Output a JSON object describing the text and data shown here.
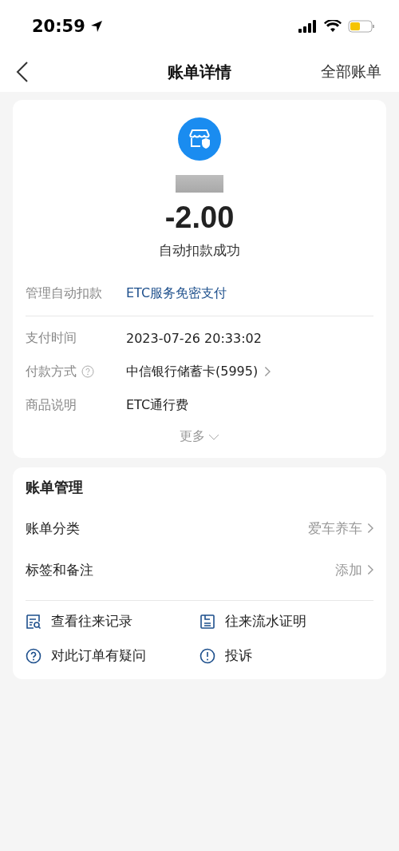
{
  "status_bar": {
    "time": "20:59"
  },
  "nav": {
    "title": "账单详情",
    "action": "全部账单"
  },
  "summary": {
    "amount": "-2.00",
    "status": "自动扣款成功",
    "manage_label": "管理自动扣款",
    "manage_link": "ETC服务免密支付"
  },
  "details": [
    {
      "label": "支付时间",
      "value": "2023-07-26 20:33:02",
      "help": false,
      "link": false
    },
    {
      "label": "付款方式",
      "value": "中信银行储蓄卡(5995)",
      "help": true,
      "link": true
    },
    {
      "label": "商品说明",
      "value": "ETC通行费",
      "help": false,
      "link": false
    }
  ],
  "more": "更多",
  "management": {
    "title": "账单管理",
    "rows": [
      {
        "label": "账单分类",
        "value": "爱车养车"
      },
      {
        "label": "标签和备注",
        "value": "添加"
      }
    ],
    "actions": [
      {
        "kind": "records",
        "label": "查看往来记录"
      },
      {
        "kind": "proof",
        "label": "往来流水证明"
      },
      {
        "kind": "question",
        "label": "对此订单有疑问"
      },
      {
        "kind": "complaint",
        "label": "投诉"
      }
    ]
  }
}
